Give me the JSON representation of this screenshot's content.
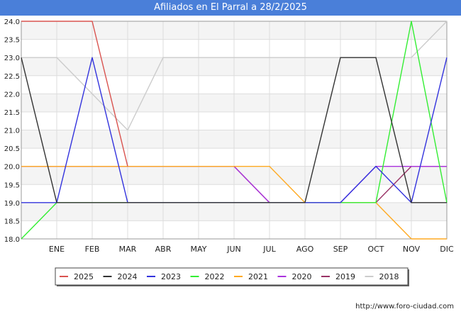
{
  "chart_data": {
    "type": "line",
    "title": "Afiliados en El Parral a 28/2/2025",
    "categories": [
      "ENE",
      "FEB",
      "MAR",
      "ABR",
      "MAY",
      "JUN",
      "JUL",
      "AGO",
      "SEP",
      "OCT",
      "NOV",
      "DIC"
    ],
    "ylim": [
      18.0,
      24.0
    ],
    "yticks": [
      "18.0",
      "18.5",
      "19.0",
      "19.5",
      "20.0",
      "20.5",
      "21.0",
      "21.5",
      "22.0",
      "22.5",
      "23.0",
      "23.5",
      "24.0"
    ],
    "grid": true,
    "legend_position": "bottom",
    "series": [
      {
        "name": "2025",
        "color": "#d9534f",
        "values": [
          24,
          24,
          24,
          20
        ]
      },
      {
        "name": "2024",
        "color": "#333333",
        "values": [
          23,
          19,
          19,
          19,
          19,
          19,
          19,
          19,
          19,
          23,
          23,
          19,
          19
        ]
      },
      {
        "name": "2023",
        "color": "#3333dd",
        "values": [
          19,
          19,
          23,
          19,
          19,
          19,
          19,
          19,
          19,
          19,
          20,
          19,
          23
        ]
      },
      {
        "name": "2022",
        "color": "#33ee33",
        "values": [
          18,
          19,
          19,
          19,
          19,
          19,
          19,
          19,
          19,
          19,
          19,
          24,
          19
        ]
      },
      {
        "name": "2021",
        "color": "#ffaa22",
        "values": [
          20,
          20,
          20,
          20,
          20,
          20,
          20,
          20,
          19,
          19,
          19,
          18,
          18
        ]
      },
      {
        "name": "2020",
        "color": "#aa33dd",
        "values": [
          20,
          20,
          20,
          20,
          20,
          20,
          20,
          19,
          19,
          19,
          20,
          20,
          20
        ]
      },
      {
        "name": "2019",
        "color": "#993366",
        "values": [
          20,
          20,
          20,
          20,
          20,
          20,
          20,
          19,
          19,
          19,
          19,
          20,
          20
        ]
      },
      {
        "name": "2018",
        "color": "#cccccc",
        "values": [
          23,
          23,
          22,
          21,
          23,
          23,
          23,
          23,
          23,
          23,
          23,
          23,
          24
        ]
      }
    ]
  },
  "footer": {
    "url": "http://www.foro-ciudad.com"
  }
}
